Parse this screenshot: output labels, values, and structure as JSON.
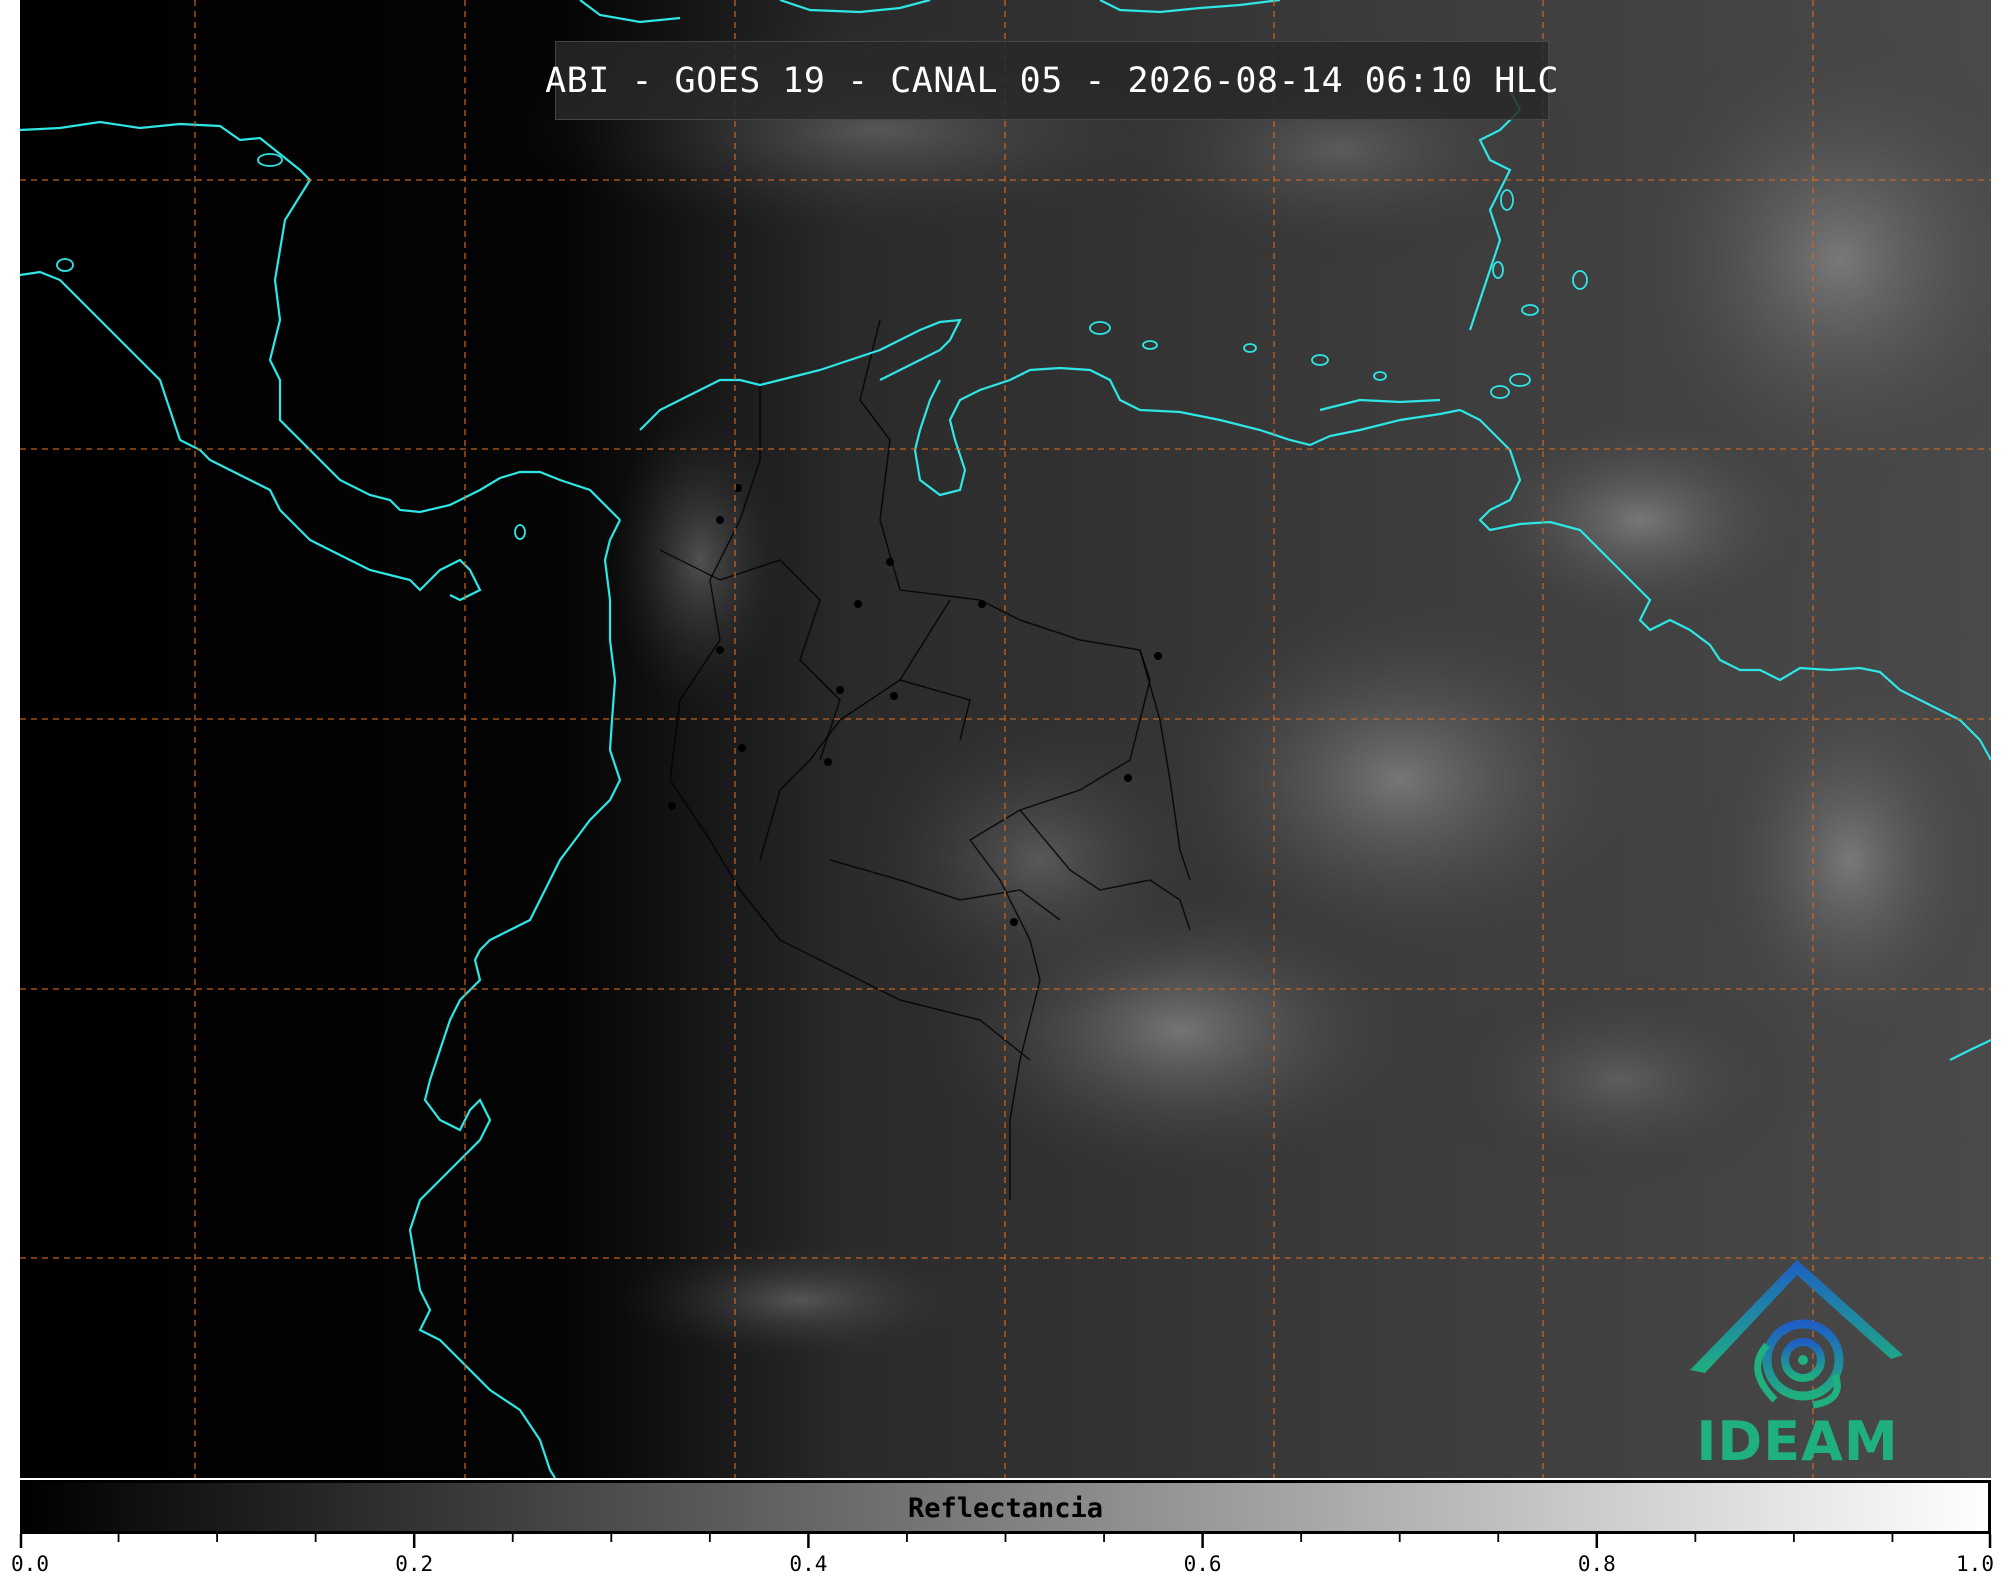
{
  "title": "ABI - GOES 19 - CANAL 05 - 2026-08-14 06:10 HLC",
  "colorbar": {
    "label": "Reflectancia",
    "min": 0.0,
    "max": 1.0,
    "ticks": [
      "0.0",
      "0.2",
      "0.4",
      "0.6",
      "0.8",
      "1.0"
    ],
    "tick_values": [
      0.0,
      0.2,
      0.4,
      0.6,
      0.8,
      1.0
    ],
    "minor_step": 0.05,
    "colors": [
      "#000000",
      "#ffffff"
    ]
  },
  "logo": {
    "text": "IDEAM",
    "colors": [
      "#1f6fc0",
      "#1fb080"
    ]
  },
  "colors": {
    "coastline": "#2ee6e6",
    "gridline": "#d2691e",
    "borders": "#000000"
  }
}
